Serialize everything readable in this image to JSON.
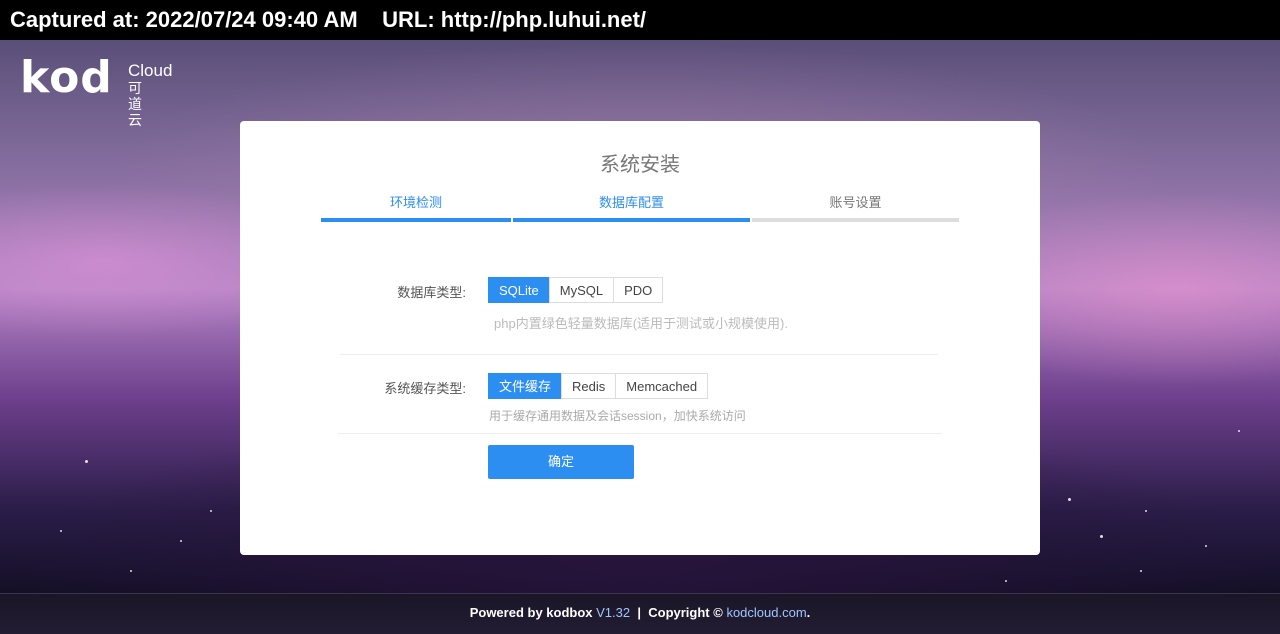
{
  "capture": {
    "text": "Captured at: 2022/07/24 09:40 AM    URL: http://php.luhui.net/"
  },
  "logo": {
    "main": "kod",
    "cloud": "Cloud",
    "cn": "可道云"
  },
  "install": {
    "title": "系统安装",
    "steps": [
      {
        "label": "环境检测",
        "status": "done"
      },
      {
        "label": "数据库配置",
        "status": "active"
      },
      {
        "label": "账号设置",
        "status": "pending"
      }
    ],
    "db": {
      "label": "数据库类型:",
      "options": [
        "SQLite",
        "MySQL",
        "PDO"
      ],
      "selected": "SQLite",
      "hint": "php内置绿色轻量数据库(适用于测试或小规模使用)."
    },
    "cache": {
      "label": "系统缓存类型:",
      "options": [
        "文件缓存",
        "Redis",
        "Memcached"
      ],
      "selected": "文件缓存",
      "hint": "用于缓存通用数据及会话session，加快系统访问"
    },
    "submit_label": "确定"
  },
  "footer": {
    "powered": "Powered by kodbox",
    "version": "V1.32",
    "sep": "|",
    "copyright": "Copyright ©",
    "site": "kodcloud.com",
    "end": "."
  },
  "colors": {
    "accent": "#2d8ef2",
    "step_pending": "#dddddd"
  }
}
